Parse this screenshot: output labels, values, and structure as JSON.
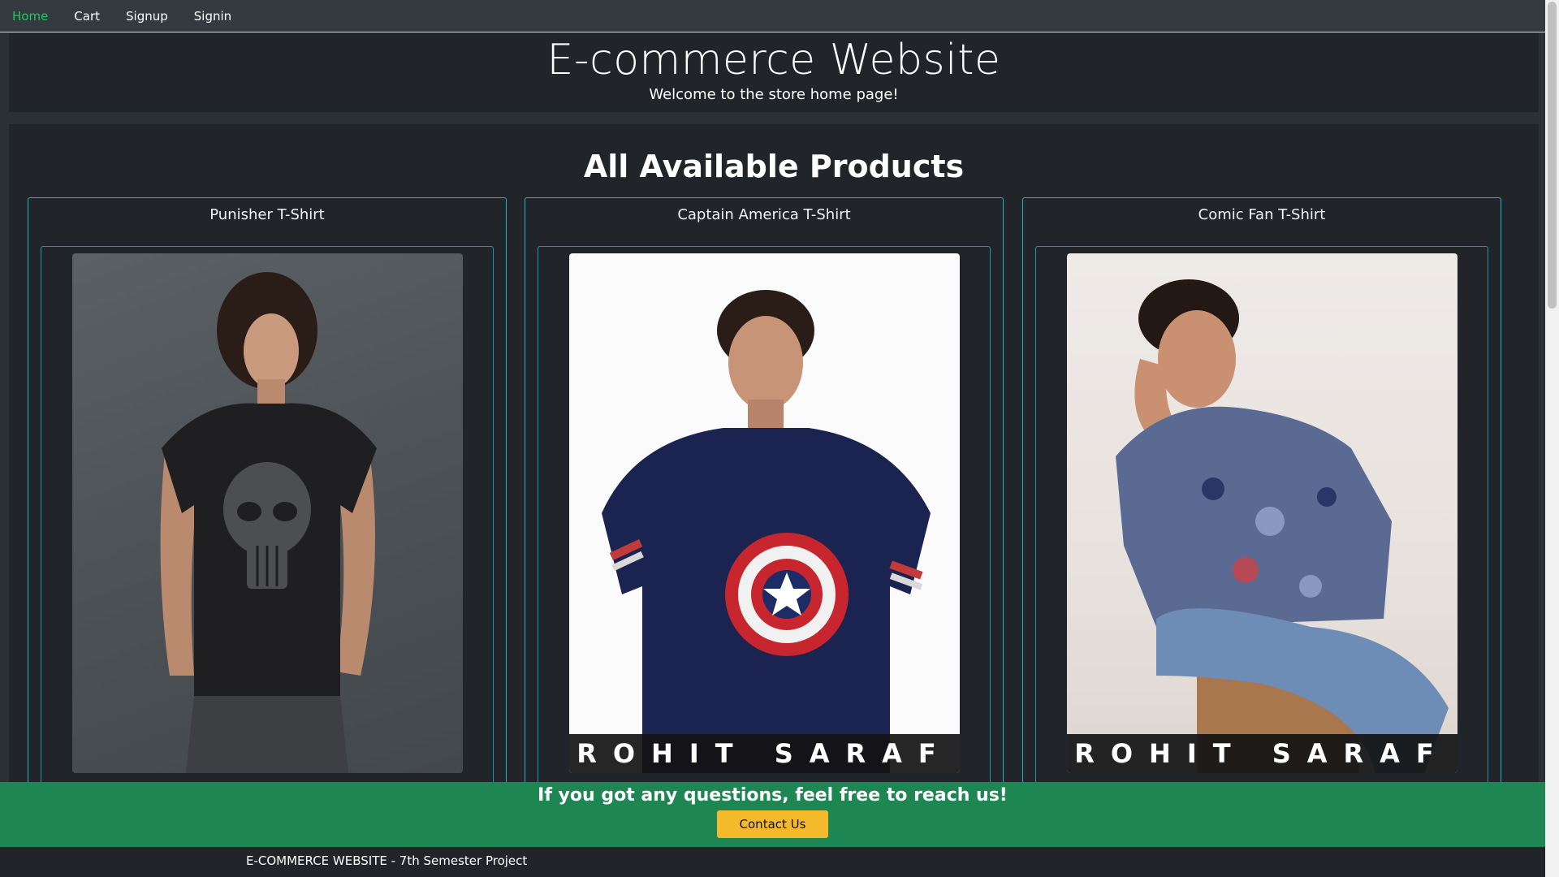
{
  "nav": {
    "items": [
      {
        "label": "Home",
        "active": true
      },
      {
        "label": "Cart",
        "active": false
      },
      {
        "label": "Signup",
        "active": false
      },
      {
        "label": "Signin",
        "active": false
      }
    ]
  },
  "hero": {
    "title": "E-commerce Website",
    "subtitle": "Welcome to the store home page!"
  },
  "products": {
    "heading": "All Available Products",
    "items": [
      {
        "name": "Punisher T-Shirt",
        "brand": ""
      },
      {
        "name": "Captain America T-Shirt",
        "brand": "ROHIT SARAF"
      },
      {
        "name": "Comic Fan T-Shirt",
        "brand": "ROHIT SARAF"
      }
    ]
  },
  "contact": {
    "message": "If you got any questions, feel free to reach us!",
    "button_label": "Contact Us"
  },
  "footer": {
    "text": "E-COMMERCE WEBSITE - 7th Semester Project"
  },
  "colors": {
    "nav_active": "#22c55e",
    "card_border": "#1ab6c7",
    "contact_bg": "#1e8652",
    "button_bg": "#f5b92c"
  }
}
